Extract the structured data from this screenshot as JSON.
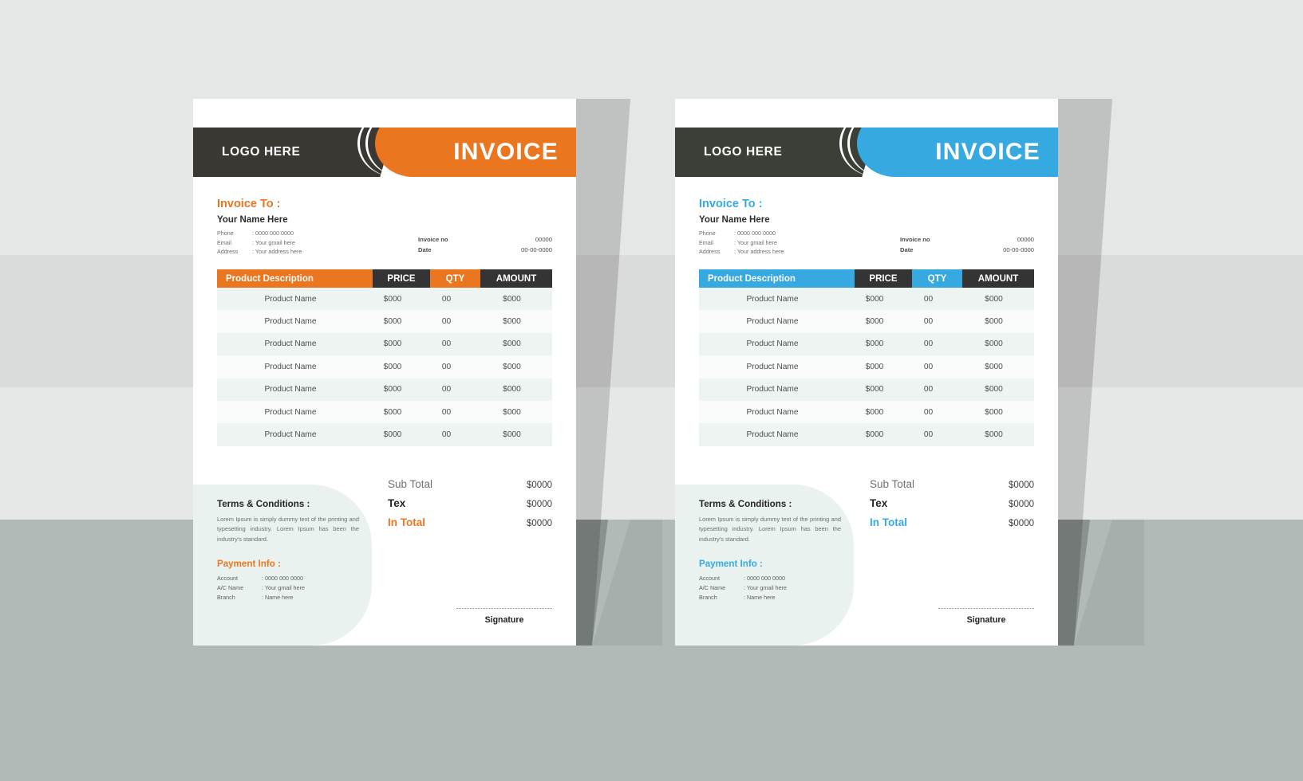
{
  "scene": {
    "background_bands": [
      "#e5e6e6",
      "#dadbdb",
      "#e6e7e7",
      "#b1bab7"
    ]
  },
  "invoices": [
    {
      "id": "orange",
      "accent": "#ea7620",
      "dark": "#3b3833",
      "dark2": "#343434",
      "header": {
        "logo": "LOGO HERE",
        "title": "INVOICE"
      },
      "billing": {
        "heading": "Invoice To :",
        "client_name": "Your Name Here",
        "fields": [
          {
            "label": "Phone",
            "value": ": 0000 000 0000"
          },
          {
            "label": "Email",
            "value": ": Your gmail here"
          },
          {
            "label": "Address",
            "value": ": Your address here"
          }
        ]
      },
      "meta": [
        {
          "label": "Invoice no",
          "value": "00000"
        },
        {
          "label": "Date",
          "value": "00-00-0000"
        }
      ],
      "table": {
        "columns": [
          "Product Description",
          "PRICE",
          "QTY",
          "AMOUNT"
        ],
        "rows": [
          {
            "description": "Product Name",
            "price": "$000",
            "qty": "00",
            "amount": "$000"
          },
          {
            "description": "Product Name",
            "price": "$000",
            "qty": "00",
            "amount": "$000"
          },
          {
            "description": "Product Name",
            "price": "$000",
            "qty": "00",
            "amount": "$000"
          },
          {
            "description": "Product Name",
            "price": "$000",
            "qty": "00",
            "amount": "$000"
          },
          {
            "description": "Product Name",
            "price": "$000",
            "qty": "00",
            "amount": "$000"
          },
          {
            "description": "Product Name",
            "price": "$000",
            "qty": "00",
            "amount": "$000"
          },
          {
            "description": "Product Name",
            "price": "$000",
            "qty": "00",
            "amount": "$000"
          }
        ]
      },
      "totals": [
        {
          "label": "Sub Total",
          "value": "$0000"
        },
        {
          "label": "Tex",
          "value": "$0000"
        },
        {
          "label": "In Total",
          "value": "$0000"
        }
      ],
      "terms": {
        "title": "Terms & Conditions :",
        "body": "Lorem Ipsum is simply dummy text of the printing and typesetting industry. Lorem Ipsum has been the industry's standard."
      },
      "payment": {
        "title": "Payment Info :",
        "fields": [
          {
            "label": "Account",
            "value": ": 0000 000 0000"
          },
          {
            "label": "A/C Name",
            "value": ": Your gmail here"
          },
          {
            "label": "Branch",
            "value": ": Name here"
          }
        ]
      },
      "signature": "Signature"
    },
    {
      "id": "blue",
      "accent": "#36a9e1",
      "dark": "#3a4038",
      "dark2": "#343434",
      "header": {
        "logo": "LOGO HERE",
        "title": "INVOICE"
      },
      "billing": {
        "heading": "Invoice To :",
        "client_name": "Your Name Here",
        "fields": [
          {
            "label": "Phone",
            "value": ": 0000 000 0000"
          },
          {
            "label": "Email",
            "value": ": Your gmail here"
          },
          {
            "label": "Address",
            "value": ": Your address here"
          }
        ]
      },
      "meta": [
        {
          "label": "Invoice no",
          "value": "00000"
        },
        {
          "label": "Date",
          "value": "00-00-0000"
        }
      ],
      "table": {
        "columns": [
          "Product Description",
          "PRICE",
          "QTY",
          "AMOUNT"
        ],
        "rows": [
          {
            "description": "Product Name",
            "price": "$000",
            "qty": "00",
            "amount": "$000"
          },
          {
            "description": "Product Name",
            "price": "$000",
            "qty": "00",
            "amount": "$000"
          },
          {
            "description": "Product Name",
            "price": "$000",
            "qty": "00",
            "amount": "$000"
          },
          {
            "description": "Product Name",
            "price": "$000",
            "qty": "00",
            "amount": "$000"
          },
          {
            "description": "Product Name",
            "price": "$000",
            "qty": "00",
            "amount": "$000"
          },
          {
            "description": "Product Name",
            "price": "$000",
            "qty": "00",
            "amount": "$000"
          },
          {
            "description": "Product Name",
            "price": "$000",
            "qty": "00",
            "amount": "$000"
          }
        ]
      },
      "totals": [
        {
          "label": "Sub Total",
          "value": "$0000"
        },
        {
          "label": "Tex",
          "value": "$0000"
        },
        {
          "label": "In Total",
          "value": "$0000"
        }
      ],
      "terms": {
        "title": "Terms & Conditions :",
        "body": "Lorem Ipsum is simply dummy text of the printing and typesetting industry. Lorem Ipsum has been the industry's standard."
      },
      "payment": {
        "title": "Payment Info :",
        "fields": [
          {
            "label": "Account",
            "value": ": 0000 000 0000"
          },
          {
            "label": "A/C Name",
            "value": ": Your gmail here"
          },
          {
            "label": "Branch",
            "value": ": Name here"
          }
        ]
      },
      "signature": "Signature"
    }
  ]
}
